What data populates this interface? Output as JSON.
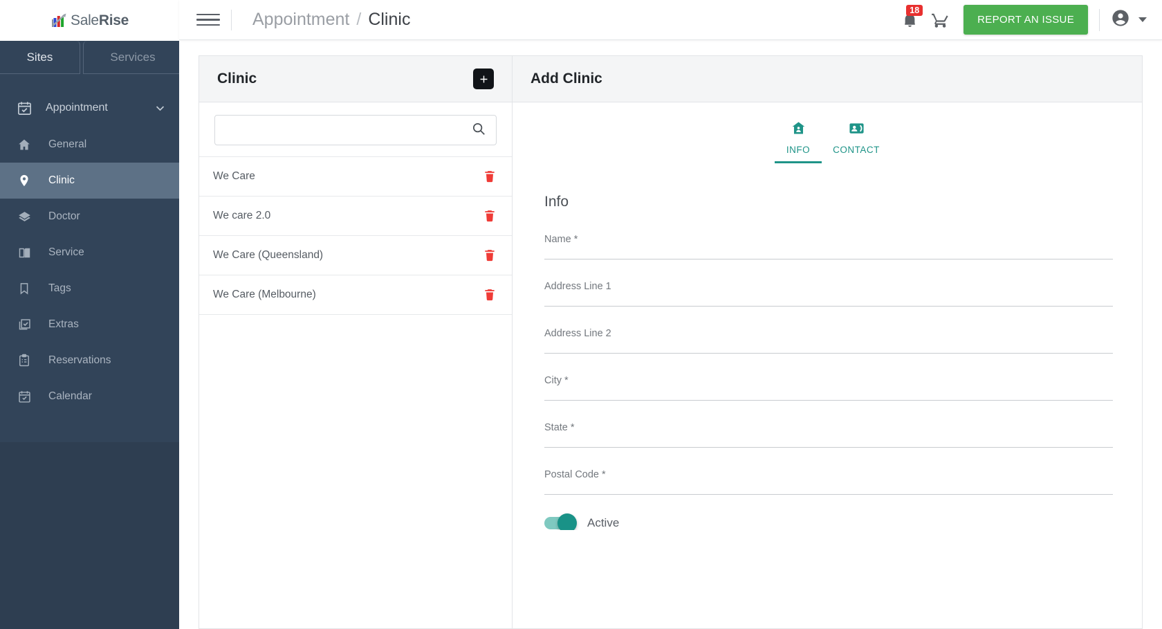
{
  "brand": {
    "name_part1": "Sale",
    "name_part2": "Rise",
    "logo_icon": "bar-chart-arrow-logo"
  },
  "sidebar": {
    "tabs": [
      {
        "label": "Sites",
        "active": true
      },
      {
        "label": "Services",
        "active": false
      }
    ],
    "section": {
      "label": "Appointment",
      "icon": "calendar-check-icon",
      "chevron": "chevron-down-icon"
    },
    "items": [
      {
        "label": "General",
        "icon": "home-icon",
        "active": false
      },
      {
        "label": "Clinic",
        "icon": "location-pin-icon",
        "active": true
      },
      {
        "label": "Doctor",
        "icon": "layers-icon",
        "active": false
      },
      {
        "label": "Service",
        "icon": "book-open-icon",
        "active": false
      },
      {
        "label": "Tags",
        "icon": "bookmark-icon",
        "active": false
      },
      {
        "label": "Extras",
        "icon": "check-square-icon",
        "active": false
      },
      {
        "label": "Reservations",
        "icon": "clipboard-list-icon",
        "active": false
      },
      {
        "label": "Calendar",
        "icon": "calendar-icon",
        "active": false
      }
    ]
  },
  "header": {
    "menu_icon": "hamburger-menu-icon",
    "breadcrumb_parent": "Appointment",
    "breadcrumb_separator": "/",
    "breadcrumb_current": "Clinic",
    "notification_icon": "bell-icon",
    "notification_count": "18",
    "cart_icon": "shopping-cart-icon",
    "report_button": "REPORT AN ISSUE",
    "account_icon": "account-circle-icon",
    "account_caret": "chevron-down-icon"
  },
  "clinic_panel": {
    "title": "Clinic",
    "add_icon": "plus-icon",
    "search": {
      "value": "",
      "placeholder": "",
      "icon": "search-icon"
    },
    "rows": [
      {
        "name": "We Care",
        "delete_icon": "trash-icon"
      },
      {
        "name": "We care 2.0",
        "delete_icon": "trash-icon"
      },
      {
        "name": "We Care (Queensland)",
        "delete_icon": "trash-icon"
      },
      {
        "name": "We Care (Melbourne)",
        "delete_icon": "trash-icon"
      }
    ]
  },
  "form_panel": {
    "title": "Add Clinic",
    "tabs": [
      {
        "label": "INFO",
        "icon": "home-work-icon",
        "active": true
      },
      {
        "label": "CONTACT",
        "icon": "contact-card-icon",
        "active": false
      }
    ],
    "section_heading": "Info",
    "fields": [
      {
        "label": "Name *",
        "value": ""
      },
      {
        "label": "Address Line 1",
        "value": ""
      },
      {
        "label": "Address Line 2",
        "value": ""
      },
      {
        "label": "City *",
        "value": ""
      },
      {
        "label": "State *",
        "value": ""
      },
      {
        "label": "Postal Code *",
        "value": ""
      }
    ],
    "toggle": {
      "label": "Active",
      "on": true
    }
  },
  "colors": {
    "sidebar_bg": "#324459",
    "sidebar_active": "#5d7186",
    "accent_teal": "#1f9488",
    "report_green": "#4caf50",
    "badge_red": "#e8302f",
    "trash_red": "#ef3b36"
  }
}
